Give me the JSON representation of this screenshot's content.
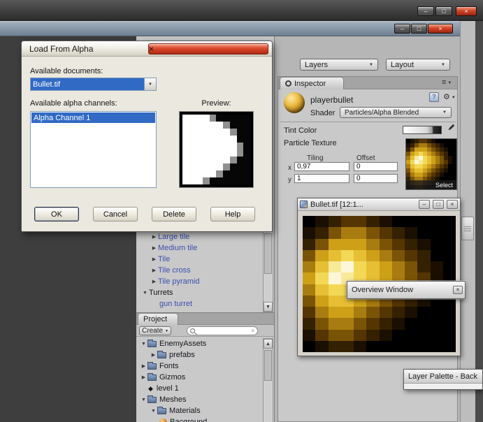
{
  "icons": {
    "minimize": "–",
    "maximize": "□",
    "close": "×",
    "dropdown_arrow": "▼",
    "foldout_open": "▼",
    "foldout_closed": "▶",
    "panel_menu": "≡",
    "scroll_up": "▲",
    "scroll_down": "▼",
    "gear": "⚙",
    "scene": "◆",
    "clear": "×",
    "help": "?"
  },
  "toolbar": {
    "layers": "Layers",
    "layout": "Layout"
  },
  "dialog": {
    "title": "Load From Alpha",
    "available_documents_label": "Available documents:",
    "document_value": "Bullet.tif",
    "alpha_channels_label": "Available alpha channels:",
    "alpha_channel_selected": "Alpha Channel 1",
    "preview_label": "Preview:",
    "ok_label": "OK",
    "cancel_label": "Cancel",
    "delete_label": "Delete",
    "help_label": "Help",
    "alpha_preview": {
      "palette": {
        "0": "#060606",
        "1": "#ffffff",
        "g": "#909090"
      },
      "rows": [
        "1111g00000",
        "111111g000",
        "1111111g00",
        "1111111100",
        "11111111g0",
        "11111111g0",
        "1111111g00",
        "111111g000",
        "11111g0000",
        "111g000000"
      ]
    }
  },
  "inspector": {
    "tab_label": "Inspector",
    "material_name": "playerbullet",
    "shader_label": "Shader",
    "shader_value": "Particles/Alpha Blended",
    "tint_color_label": "Tint Color",
    "particle_texture_label": "Particle Texture",
    "tiling_header": "Tiling",
    "offset_header": "Offset",
    "row_x_label": "x",
    "row_y_label": "y",
    "tiling_x": "0,97",
    "offset_x": "0",
    "tiling_y": "1",
    "offset_y": "0",
    "select_label": "Select"
  },
  "texture_window": {
    "title": "Bullet.tif [12:1...",
    "pixels": {
      "palette": {
        "0": "#000000",
        "1": "#1a0f00",
        "2": "#342101",
        "3": "#553502",
        "4": "#7a5406",
        "5": "#a87c10",
        "6": "#cda018",
        "7": "#e6bf34",
        "8": "#f3d855",
        "9": "#f9ea9a",
        "w": "#fdf7d8"
      },
      "rows": [
        "012332100000",
        "124554321000",
        "246665432100",
        "467876543200",
        "579w87654210",
        "68w987654310",
        "578876543200",
        "467765432100",
        "356654321000",
        "245543210000",
        "134432100000",
        "012210000000"
      ]
    }
  },
  "overview_window": {
    "title": "Overview Window"
  },
  "layer_palette": {
    "title": "Layer Palette - Back"
  },
  "hierarchy": {
    "items": [
      {
        "label": "Large tile"
      },
      {
        "label": "Medium tile"
      },
      {
        "label": "Tile"
      },
      {
        "label": "Tile cross"
      },
      {
        "label": "Tile pyramid"
      },
      {
        "label": "Turrets"
      },
      {
        "label": "gun turret"
      }
    ]
  },
  "project": {
    "tab_label": "Project",
    "create_label": "Create",
    "items": [
      {
        "label": "EnemyAssets"
      },
      {
        "label": "prefabs"
      },
      {
        "label": "Fonts"
      },
      {
        "label": "Gizmos"
      },
      {
        "label": "level 1"
      },
      {
        "label": "Meshes"
      },
      {
        "label": "Materials"
      },
      {
        "label": "Bacground"
      }
    ]
  },
  "colors": {
    "selection_blue": "#316ac5",
    "prefab_text_blue": "#3a4fae",
    "close_red": "#c23a22",
    "panel_gray": "#c9c9c9"
  }
}
